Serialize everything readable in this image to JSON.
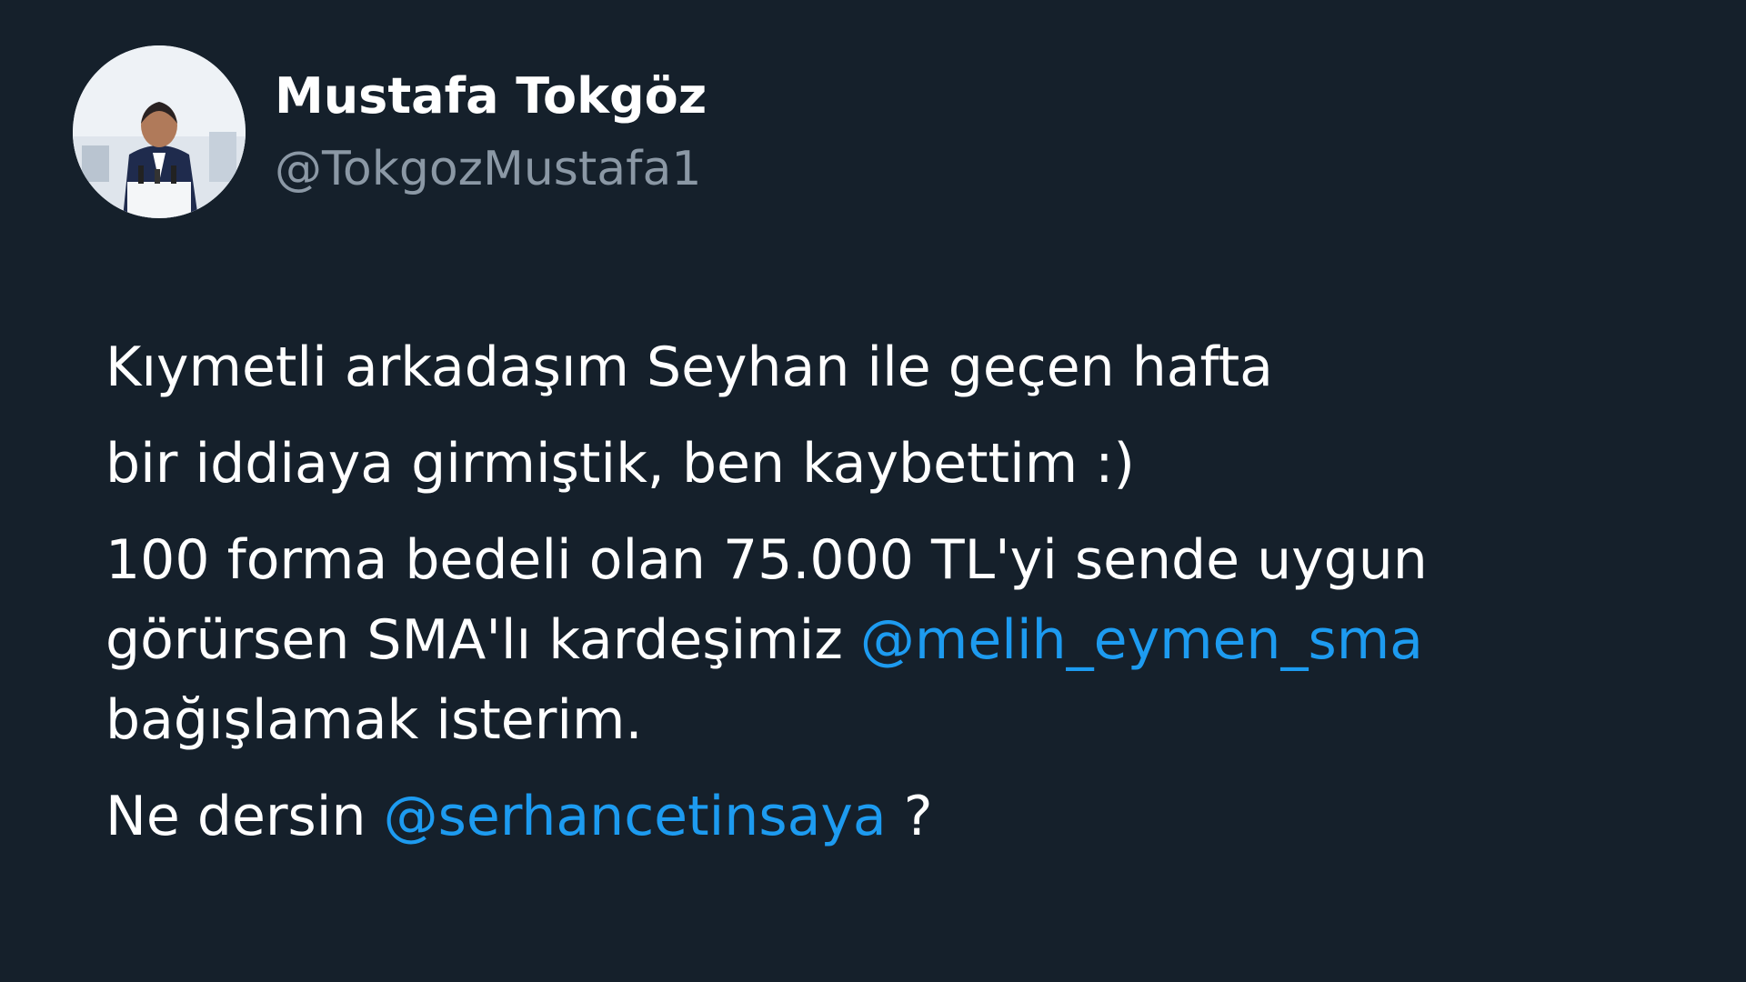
{
  "author": {
    "display_name": "Mustafa Tokgöz",
    "handle": "@TokgozMustafa1"
  },
  "tweet": {
    "line1": "Kıymetli arkadaşım Seyhan ile geçen hafta",
    "line2": "bir iddiaya girmiştik, ben kaybettim :)",
    "line3": "100 forma bedeli olan 75.000 TL'yi sende uygun",
    "line4_text": "görürsen SMA'lı kardeşimiz ",
    "line4_mention": "@melih_eymen_sma",
    "line5": "bağışlamak isterim.",
    "line6_text": "Ne dersin ",
    "line6_mention": "@serhancetinsaya",
    "line6_end": " ?"
  },
  "colors": {
    "background": "#15202b",
    "text": "#ffffff",
    "secondary_text": "#8b98a5",
    "mention": "#1d9bf0"
  }
}
